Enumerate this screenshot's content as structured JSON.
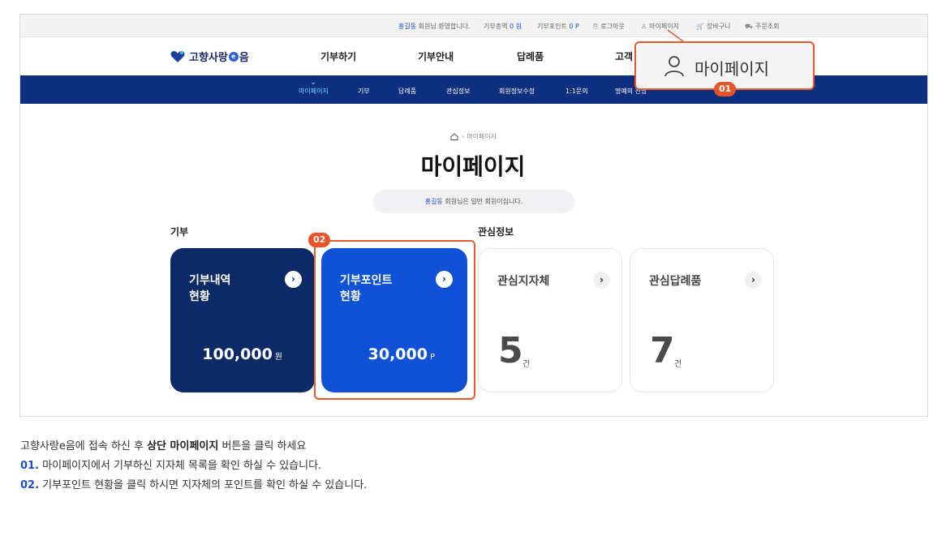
{
  "util_bar": {
    "user_name": "홍길동",
    "welcome_suffix": "회원님 환영합니다.",
    "donation_total_label": "기부총액",
    "donation_total_value": "0 원",
    "donation_point_label": "기부포인트",
    "donation_point_value": "0 P",
    "logout": "로그아웃",
    "mypage": "마이페이지",
    "cart": "장바구니",
    "orders": "주문조회"
  },
  "header": {
    "logo_text_1": "고향사랑",
    "logo_e": "e",
    "logo_text_2": "음",
    "gnb": [
      "기부하기",
      "기부안내",
      "답례품",
      "고객"
    ]
  },
  "subnav": [
    "마이페이지",
    "기부",
    "답례품",
    "관심정보",
    "회원정보수정",
    "1:1문의",
    "명예의 전당"
  ],
  "callout": {
    "label": "마이페이지",
    "badge1": "01",
    "badge2": "02"
  },
  "breadcrumb": {
    "current": "마이페이지"
  },
  "page": {
    "title": "마이페이지",
    "greet_name": "홍길동",
    "greet_text": "회원님은 일반 회원이십니다."
  },
  "sections": {
    "donation": "기부",
    "interest": "관심정보"
  },
  "cards": {
    "history": {
      "title": "기부내역\n현황",
      "value": "100,000",
      "unit": "원"
    },
    "points": {
      "title": "기부포인트\n현황",
      "value": "30,000",
      "unit": "P"
    },
    "regions": {
      "title": "관심지자체",
      "value": "5",
      "unit": "건"
    },
    "gifts": {
      "title": "관심답례품",
      "value": "7",
      "unit": "건"
    }
  },
  "instructions": {
    "line1_a": "고향사랑e음에 접속 하신 후 ",
    "line1_b": "상단 마이페이지",
    "line1_c": " 버튼을 클릭 하세요",
    "line2_num": "01.",
    "line2_text": " 마이페이지에서 기부하신 지자체 목록을 확인 하실 수 있습니다.",
    "line3_num": "02.",
    "line3_text": " 기부포인트 현황을 클릭 하시면 지자체의 포인트를 확인 하실 수 있습니다."
  },
  "colors": {
    "navy": "#0c2a66",
    "blue": "#0f52d6",
    "accent": "#e8592b",
    "link": "#1f4fc7"
  }
}
